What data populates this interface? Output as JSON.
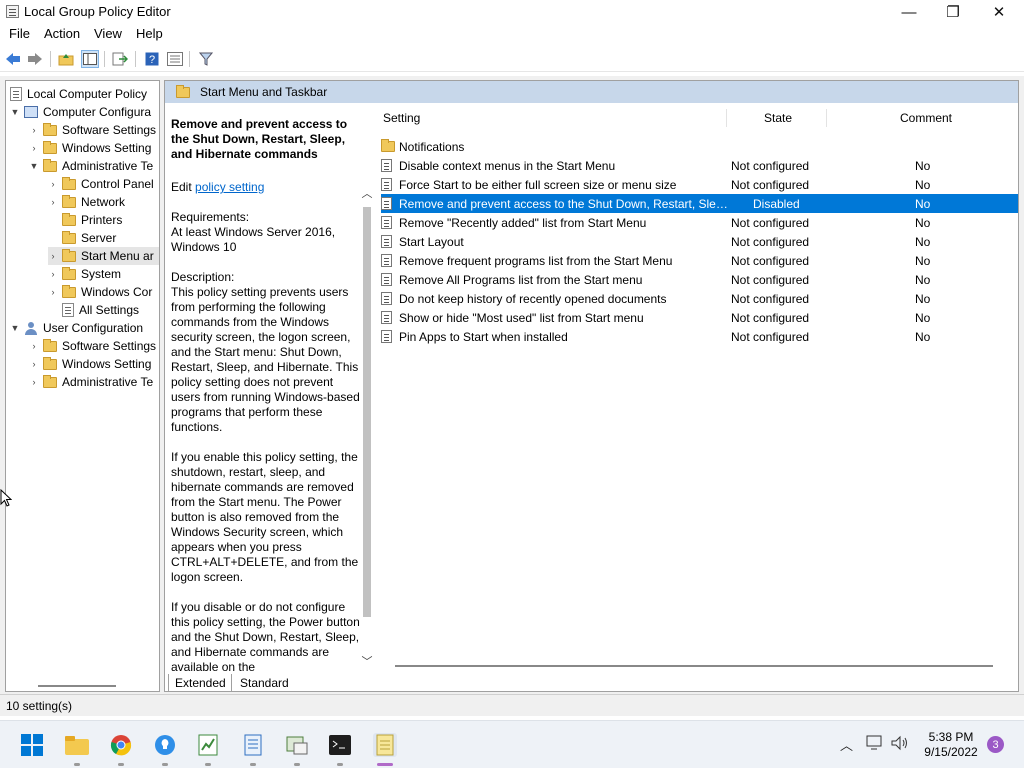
{
  "window": {
    "title": "Local Group Policy Editor",
    "minimize_glyph": "—",
    "maximize_glyph": "❐",
    "close_glyph": "✕"
  },
  "menu": [
    "File",
    "Action",
    "View",
    "Help"
  ],
  "toolbar_icons": [
    "back-arrow-icon",
    "forward-arrow-icon",
    "up-folder-icon",
    "show-hide-tree-icon",
    "export-list-icon",
    "help-icon",
    "properties-icon",
    "filter-icon"
  ],
  "tree": {
    "root": "Local Computer Policy",
    "computer_config": "Computer Configura",
    "cc_software": "Software Settings",
    "cc_windows": "Windows Setting",
    "cc_admin": "Administrative Te",
    "control_panel": "Control Panel",
    "network": "Network",
    "printers": "Printers",
    "server": "Server",
    "start_menu": "Start Menu ar",
    "system": "System",
    "windows_components": "Windows Cor",
    "all_settings": "All Settings",
    "user_config": "User Configuration",
    "uc_software": "Software Settings",
    "uc_windows": "Windows Setting",
    "uc_admin": "Administrative Te"
  },
  "right_header": "Start Menu and Taskbar",
  "description": {
    "title": "Remove and prevent access to the Shut Down, Restart, Sleep, and Hibernate commands",
    "edit_prefix": "Edit",
    "edit_link": "policy setting",
    "requirements_label": "Requirements:",
    "requirements": "At least Windows Server 2016, Windows 10",
    "description_label": "Description:",
    "para1": "This policy setting prevents users from performing the following commands from the Windows security screen, the logon screen, and the Start menu: Shut Down, Restart, Sleep, and Hibernate. This policy setting does not prevent users from running Windows-based programs that perform these functions.",
    "para2": "If you enable this policy setting, the shutdown, restart, sleep, and hibernate commands are removed from the Start menu. The Power button is also removed from the Windows Security screen, which appears when you press CTRL+ALT+DELETE, and from the logon screen.",
    "para3": "If you disable or do not configure this policy setting, the Power button and the Shut Down, Restart, Sleep, and Hibernate commands are available on the"
  },
  "columns": {
    "setting": "Setting",
    "state": "State",
    "comment": "Comment"
  },
  "folder_row": "Notifications",
  "rows": [
    {
      "setting": "Disable context menus in the Start Menu",
      "state": "Not configured",
      "comment": "No"
    },
    {
      "setting": "Force Start to be either full screen size or menu size",
      "state": "Not configured",
      "comment": "No"
    },
    {
      "setting": "Remove and prevent access to the Shut Down, Restart, Sleep...",
      "state": "Disabled",
      "comment": "No"
    },
    {
      "setting": "Remove \"Recently added\" list from Start Menu",
      "state": "Not configured",
      "comment": "No"
    },
    {
      "setting": "Start Layout",
      "state": "Not configured",
      "comment": "No"
    },
    {
      "setting": "Remove frequent programs list from the Start Menu",
      "state": "Not configured",
      "comment": "No"
    },
    {
      "setting": "Remove All Programs list from the Start menu",
      "state": "Not configured",
      "comment": "No"
    },
    {
      "setting": "Do not keep history of recently opened documents",
      "state": "Not configured",
      "comment": "No"
    },
    {
      "setting": "Show or hide \"Most used\" list from Start menu",
      "state": "Not configured",
      "comment": "No"
    },
    {
      "setting": "Pin Apps to Start when installed",
      "state": "Not configured",
      "comment": "No"
    }
  ],
  "tabs": [
    "Extended",
    "Standard"
  ],
  "status": "10 setting(s)",
  "taskbar": {
    "apps": [
      "start-icon",
      "file-explorer-icon",
      "chrome-icon",
      "tips-icon",
      "spreadsheet-icon",
      "notepad-icon",
      "group-policy-icon",
      "terminal-icon",
      "notes-icon"
    ],
    "time": "5:38 PM",
    "date": "9/15/2022",
    "notification_count": "3"
  },
  "colors": {
    "selection": "#0078d7",
    "header_bar": "#c7d7ea",
    "link": "#0066cc"
  }
}
